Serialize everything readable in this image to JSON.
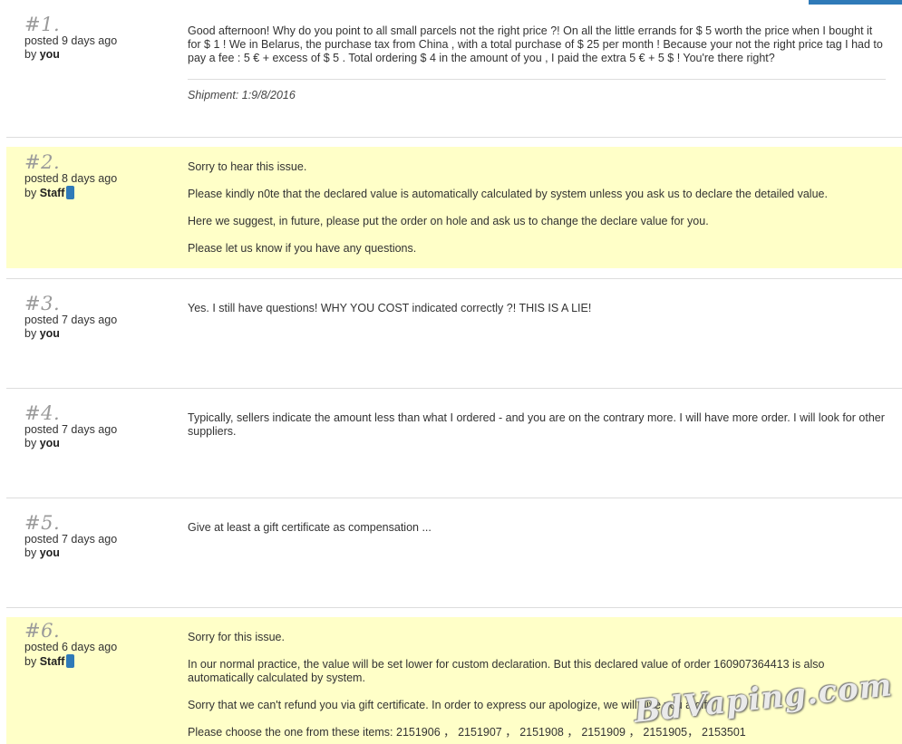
{
  "posts": [
    {
      "number": "#1.",
      "posted": "posted 9 days ago",
      "by_prefix": "by",
      "author": "you",
      "paragraphs": [
        "Good afternoon! Why do you point to all small parcels not the right price ?! On all the little errands for $ 5 worth the price when I bought it for $ 1 ! We in Belarus, the purchase tax from China , with a total purchase of $ 25 per month ! Because your not the right price tag I had to pay a fee : 5 € + excess of $ 5 . Total ordering $ 4 in the amount of you , I paid the extra 5 € + 5 $ ! You're there right?"
      ],
      "shipment": "Shipment: 1:9/8/2016"
    },
    {
      "number": "#2.",
      "posted": "posted 8 days ago",
      "by_prefix": "by",
      "author": "Staff",
      "paragraphs": [
        "Sorry to hear this issue.",
        "Please kindly n0te that the declared value is automatically calculated by system unless you ask us to declare the detailed value.",
        "Here we suggest, in future, please put the order on hole and ask us to change the declare value for you.",
        "Please let us know if you have any questions."
      ]
    },
    {
      "number": "#3.",
      "posted": "posted 7 days ago",
      "by_prefix": "by",
      "author": "you",
      "paragraphs": [
        "Yes. I still have questions! WHY YOU COST indicated correctly ?! THIS IS A LIE!"
      ]
    },
    {
      "number": "#4.",
      "posted": "posted 7 days ago",
      "by_prefix": "by",
      "author": "you",
      "paragraphs": [
        "Typically, sellers indicate the amount less than what I ordered - and you are on the contrary more. I will have more order. I will look for other suppliers."
      ]
    },
    {
      "number": "#5.",
      "posted": "posted 7 days ago",
      "by_prefix": "by",
      "author": "you",
      "paragraphs": [
        "Give at least a gift certificate as compensation ..."
      ]
    },
    {
      "number": "#6.",
      "posted": "posted 6 days ago",
      "by_prefix": "by",
      "author": "Staff",
      "paragraphs": [
        "Sorry for this issue.",
        "In our normal practice, the value will be set lower for custom declaration. But this declared value of order 160907364413 is also automatically calculated by system.",
        "Sorry that we can't refund you via gift certificate. In order to express our apologize, we will give you a gift.",
        "Please choose the one from these items: 2151906 ， 2151907 ， 2151908 ， 2151909 ， 2151905， 2153501"
      ]
    }
  ],
  "watermark": "BdVaping.com",
  "colors": {
    "staff_background": "#ffffc8",
    "badge": "#2f7ab8",
    "separator": "#dddddd"
  }
}
